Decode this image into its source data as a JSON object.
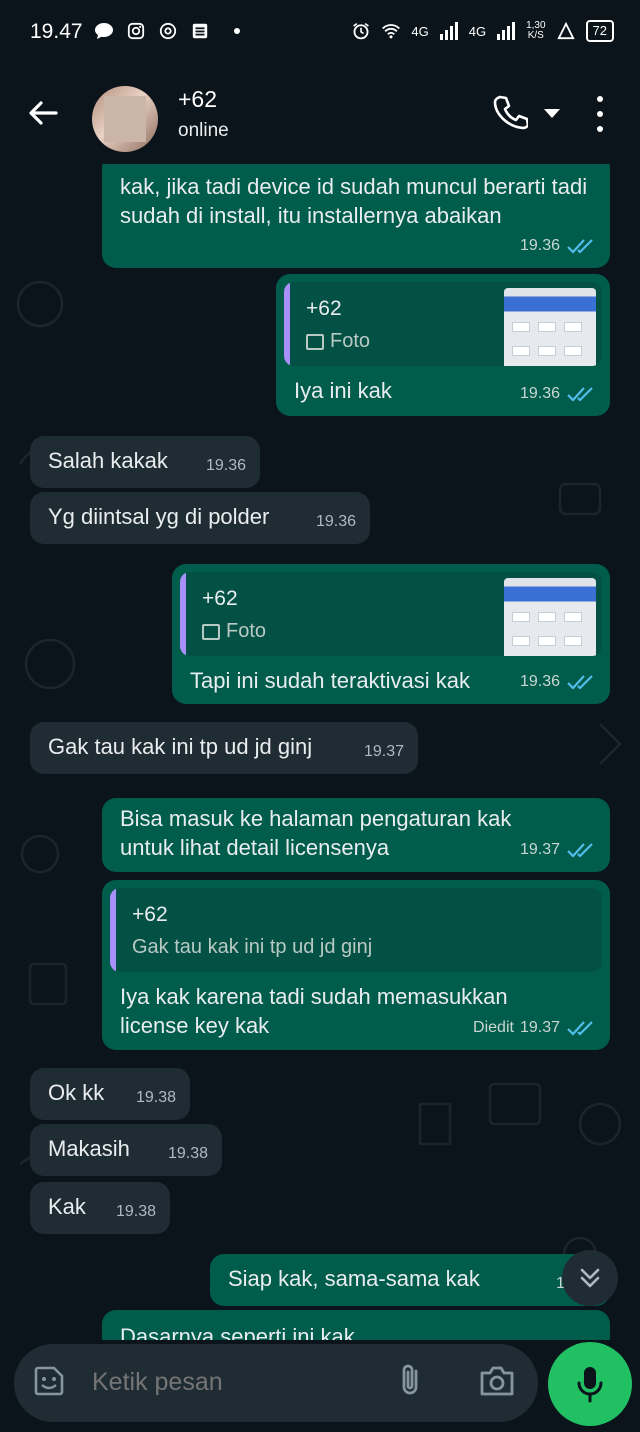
{
  "status_bar": {
    "time": "19.47",
    "net1": "4G",
    "net2": "4G",
    "speed_top": "1,30",
    "speed_bottom": "K/S",
    "battery": "72"
  },
  "header": {
    "contact_name": "+62",
    "contact_status": "online"
  },
  "messages": [
    {
      "side": "out",
      "text": "kak, jika tadi device id sudah muncul berarti tadi sudah di install, itu installernya abaikan",
      "time": "19.36"
    },
    {
      "side": "out",
      "quote_name": "+62",
      "quote_sub": "Foto",
      "text": "Iya ini kak",
      "time": "19.36"
    },
    {
      "side": "in",
      "text": "Salah kakak",
      "time": "19.36"
    },
    {
      "side": "in",
      "text": "Yg diintsal yg di polder",
      "time": "19.36"
    },
    {
      "side": "out",
      "quote_name": "+62",
      "quote_sub": "Foto",
      "text": "Tapi ini sudah teraktivasi kak",
      "time": "19.36"
    },
    {
      "side": "in",
      "text": "Gak tau kak ini tp ud jd ginj",
      "time": "19.37"
    },
    {
      "side": "out",
      "text": "Bisa masuk ke halaman pengaturan kak untuk lihat detail licensenya",
      "time": "19.37"
    },
    {
      "side": "out",
      "quote_name": "+62",
      "quote_sub": "Gak tau kak ini tp ud jd ginj",
      "text": "Iya kak karena tadi sudah memasukkan license key kak",
      "edited": "Diedit",
      "time": "19.37"
    },
    {
      "side": "in",
      "text": "Ok kk",
      "time": "19.38"
    },
    {
      "side": "in",
      "text": "Makasih",
      "time": "19.38"
    },
    {
      "side": "in",
      "text": "Kak",
      "time": "19.38"
    },
    {
      "side": "out",
      "text": "Siap kak, sama-sama kak",
      "time": "19.38"
    },
    {
      "side": "out",
      "text": "Dasarnya seperti ini kak",
      "time": ""
    }
  ],
  "input": {
    "placeholder": "Ketik pesan"
  },
  "colors": {
    "background": "#0b141a",
    "incoming": "#202c33",
    "outgoing": "#005c4b",
    "accent_green": "#21c063",
    "read_tick": "#53bdeb"
  }
}
